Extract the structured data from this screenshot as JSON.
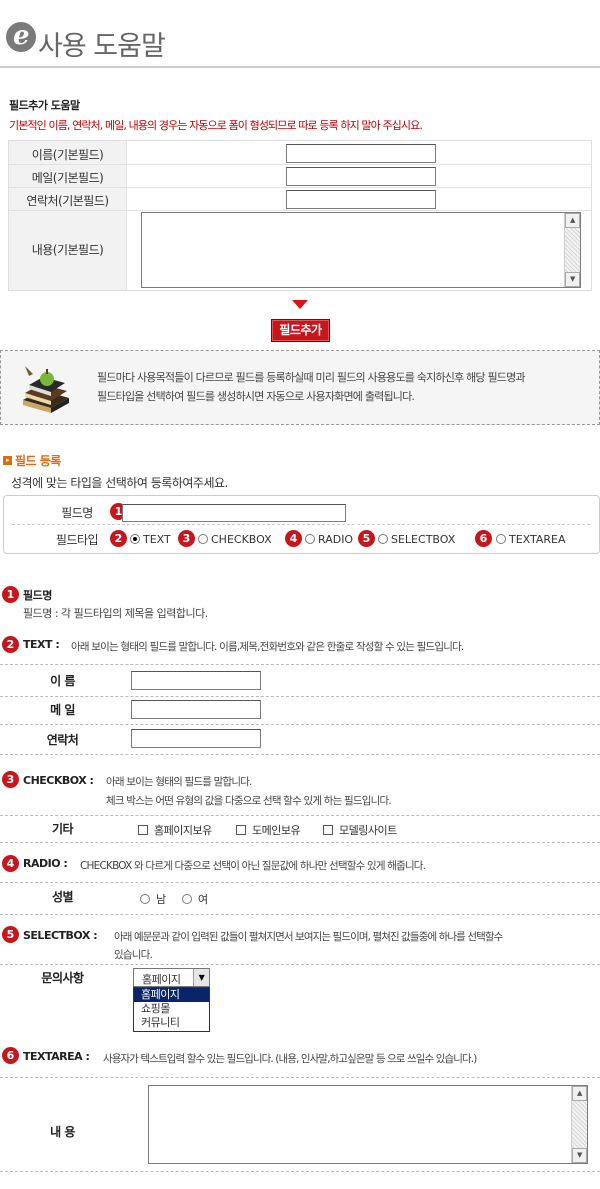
{
  "header": {
    "logo_letter": "e",
    "title": "사용 도움말"
  },
  "field_help": {
    "heading": "필드추가 도움말",
    "notice": "기본적인 이름, 연락처, 메일, 내용의 경우는 자동으로 폼이 형성되므로 따로 등록 하지 말아 주십시요.",
    "rows": [
      {
        "label": "이름(기본필드)"
      },
      {
        "label": "메일(기본필드)"
      },
      {
        "label": "연락처(기본필드)"
      },
      {
        "label": "내용(기본필드)"
      }
    ],
    "add_button": "필드추가"
  },
  "info_box": {
    "line1": "필드마다 사용목적들이 다르므로 필드를 등록하실때 미리 필드의 사용용도를 숙지하신후 해당 필드명과",
    "line2": "필드타입을 선택하여 필드를 생성하시면 자동으로 사용자화면에 출력됩니다."
  },
  "register": {
    "title": "필드 등록",
    "subtitle": "성격에 맞는 타입을 선택하여 등록하여주세요.",
    "name_label": "필드명",
    "type_label": "필드타입",
    "types": [
      "TEXT",
      "CHECKBOX",
      "RADIO",
      "SELECTBOX",
      "TEXTAREA"
    ],
    "selected_type": "TEXT"
  },
  "help": {
    "s1_title": "필드명",
    "s1_desc": "필드명 : 각 필드타입의 제목을 입력합니다.",
    "s2_title": "TEXT",
    "s2_desc": "아래 보이는 형태의 필드를 말합니다. 이름,제목,전화번호와 같은 한줄로 작성할 수 있는 필드입니다.",
    "s2_fields": [
      "이 름",
      "메 일",
      "연락처"
    ],
    "s3_title": "CHECKBOX",
    "s3_desc1": "아래 보이는 형태의 필드를 말합니다.",
    "s3_desc2": "체크 박스는 어떤 유형의 값을 다중으로 선택 할수 있게 하는 필드입니다.",
    "s3_label": "기타",
    "s3_options": [
      "홈페이지보유",
      "도메인보유",
      "모델링사이트"
    ],
    "s4_title": "RADIO",
    "s4_desc": "CHECKBOX 와 다르게 다중으로 선택이 아닌 질문값에 하나만 선택할수 있게 해줍니다.",
    "s4_label": "성별",
    "s4_options": [
      "남",
      "여"
    ],
    "s5_title": "SELECTBOX",
    "s5_desc1": "아래 예문문과 같이 입력된 값들이 펼쳐지면서 보여지는 필드이며, 펼쳐진 값들중에 하나를 선택할수",
    "s5_desc2": "있습니다.",
    "s5_label": "문의사항",
    "s5_selected": "홈페이지",
    "s5_options": [
      "홈페이지",
      "쇼핑몰",
      "커뮤니티"
    ],
    "s6_title": "TEXTAREA",
    "s6_desc": "사용자가 텍스트입력 할수 있는 필드입니다. (내용, 인사말,하고싶은말 등 으로 쓰일수 있습니다.)",
    "s6_label": "내 용"
  },
  "colors": {
    "accent": "#c8161d",
    "orange": "#e06a10",
    "notice": "#c00000"
  }
}
